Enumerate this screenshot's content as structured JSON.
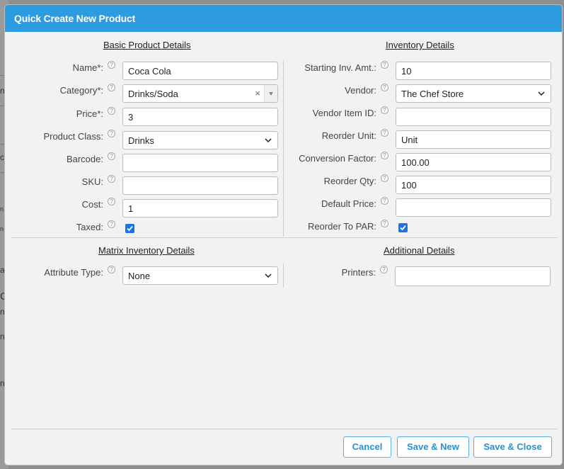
{
  "background": {
    "glyphs": [
      "n",
      "c",
      "n",
      "n",
      "at",
      "C",
      "n",
      "n",
      "n"
    ]
  },
  "dialog": {
    "title": "Quick Create New Product"
  },
  "sections": {
    "basic": "Basic Product Details",
    "inventory": "Inventory Details",
    "matrix": "Matrix Inventory Details",
    "additional": "Additional Details"
  },
  "help_glyph": "?",
  "basic": {
    "name": {
      "label": "Name*:",
      "value": "Coca Cola"
    },
    "category": {
      "label": "Category*:",
      "value": "Drinks/Soda",
      "clear": "×"
    },
    "price": {
      "label": "Price*:",
      "value": "3"
    },
    "product_class": {
      "label": "Product Class:",
      "value": "Drinks"
    },
    "barcode": {
      "label": "Barcode:",
      "value": ""
    },
    "sku": {
      "label": "SKU:",
      "value": ""
    },
    "cost": {
      "label": "Cost:",
      "value": "1"
    },
    "taxed": {
      "label": "Taxed:",
      "checked": true
    }
  },
  "inventory": {
    "starting_inv": {
      "label": "Starting Inv. Amt.:",
      "value": "10"
    },
    "vendor": {
      "label": "Vendor:",
      "value": "The Chef Store"
    },
    "vendor_item_id": {
      "label": "Vendor Item ID:",
      "value": ""
    },
    "reorder_unit": {
      "label": "Reorder Unit:",
      "value": "Unit"
    },
    "conversion_factor": {
      "label": "Conversion Factor:",
      "value": "100.00"
    },
    "reorder_qty": {
      "label": "Reorder Qty:",
      "value": "100"
    },
    "default_price": {
      "label": "Default Price:",
      "value": ""
    },
    "reorder_to_par": {
      "label": "Reorder To PAR:",
      "checked": true
    }
  },
  "matrix": {
    "attribute_type": {
      "label": "Attribute Type:",
      "value": "None"
    }
  },
  "additional": {
    "printers": {
      "label": "Printers:",
      "value": ""
    }
  },
  "buttons": {
    "cancel": "Cancel",
    "save_new": "Save & New",
    "save_close": "Save & Close"
  },
  "colors": {
    "titlebar": "#2d9be0",
    "checkbox": "#1a73e8",
    "button_text": "#2a8fd0"
  }
}
